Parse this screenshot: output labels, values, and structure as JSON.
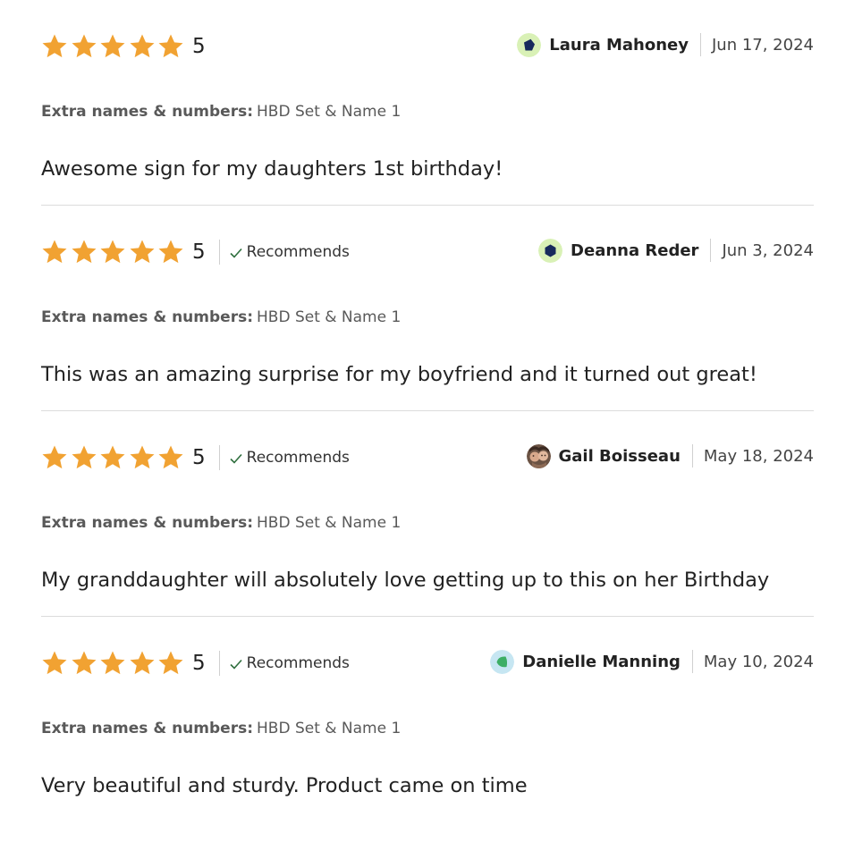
{
  "colors": {
    "star": "#f1a232",
    "check": "#2f6f3e",
    "divider": "#dcdcdc",
    "text": "#222222",
    "muted": "#595959"
  },
  "icons": {
    "star": "star-icon",
    "check": "checkmark-icon"
  },
  "reviews": [
    {
      "rating": "5",
      "stars": 5,
      "recommends": false,
      "recommends_label": "",
      "reviewer_name": "Laura Mahoney",
      "date": "Jun 17, 2024",
      "avatar": "navy-pentagon-avatar",
      "variation_label": "Extra names & numbers:",
      "variation_value": "HBD Set & Name 1",
      "text": "Awesome sign for my daughters 1st birthday!"
    },
    {
      "rating": "5",
      "stars": 5,
      "recommends": true,
      "recommends_label": "Recommends",
      "reviewer_name": "Deanna Reder",
      "date": "Jun 3, 2024",
      "avatar": "navy-hexagon-avatar",
      "variation_label": "Extra names & numbers:",
      "variation_value": "HBD Set & Name 1",
      "text": "This was an amazing surprise for my boyfriend and it turned out great!"
    },
    {
      "rating": "5",
      "stars": 5,
      "recommends": true,
      "recommends_label": "Recommends",
      "reviewer_name": "Gail Boisseau",
      "date": "May 18, 2024",
      "avatar": "photo-avatar",
      "variation_label": "Extra names & numbers:",
      "variation_value": "HBD Set & Name 1",
      "text": "My granddaughter will absolutely love getting up to this on her Birthday"
    },
    {
      "rating": "5",
      "stars": 5,
      "recommends": true,
      "recommends_label": "Recommends",
      "reviewer_name": "Danielle Manning",
      "date": "May 10, 2024",
      "avatar": "green-leaf-avatar",
      "variation_label": "Extra names & numbers:",
      "variation_value": "HBD Set & Name 1",
      "text": "Very beautiful and sturdy. Product came on time"
    }
  ]
}
